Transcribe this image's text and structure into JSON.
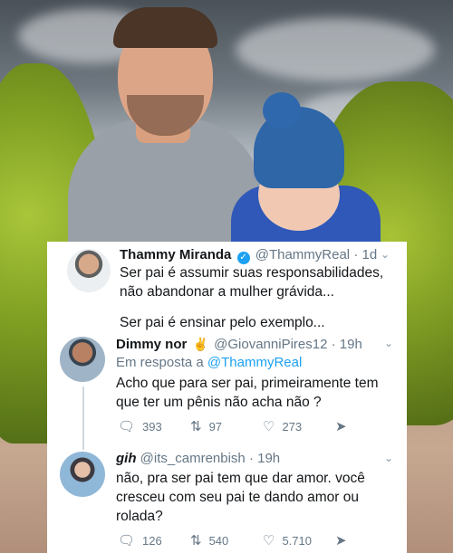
{
  "tweet1": {
    "name": "Thammy Miranda",
    "verified_mark": "✓",
    "handle": "@ThammyReal",
    "time": "· 1d",
    "line1": "Ser pai é assumir suas responsabilidades,",
    "line2": "não abandonar a mulher grávida...",
    "line3": "Ser pai é ensinar pelo exemplo..."
  },
  "tweet2": {
    "name": "Dimmy nor",
    "handle": "@GiovanniPires12",
    "time": "· 19h",
    "reply_prefix": "Em resposta a",
    "reply_to": "@ThammyReal",
    "line1": "Acho que para ser pai, primeiramente tem",
    "line2": "que ter um pênis não acha não ?",
    "replies": "393",
    "retweets": "97",
    "likes": "273"
  },
  "tweet3": {
    "name": "gih",
    "handle": "@its_camrenbish",
    "time": "· 19h",
    "line1": "não, pra ser pai tem que dar amor. você",
    "line2": "cresceu com seu pai te dando amor ou",
    "line3": "rolada?",
    "replies": "126",
    "retweets": "540",
    "likes": "5.710"
  },
  "icons": {
    "reply": "reply-icon",
    "retweet": "retweet-icon",
    "like": "heart-icon",
    "share": "share-icon",
    "caret": "chevron-down-icon"
  },
  "colors": {
    "accent": "#1da1f2",
    "muted": "#657786",
    "text": "#14171a"
  }
}
